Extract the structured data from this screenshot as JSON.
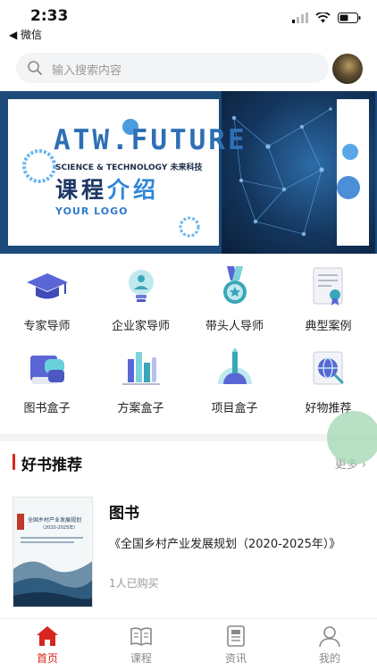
{
  "status_bar": {
    "time": "2:33",
    "back_app": "◀ 微信"
  },
  "search": {
    "placeholder": "输入搜索内容"
  },
  "banner": {
    "title": "ATW.FUTURE",
    "subtitle": "SCIENCE & TECHNOLOGY 未来科技",
    "heading_dark": "课程",
    "heading_light": "介绍",
    "logo_text": "YOUR LOGO"
  },
  "grid": [
    {
      "label": "专家导师",
      "icon": "graduation-cap-icon"
    },
    {
      "label": "企业家导师",
      "icon": "lightbulb-person-icon"
    },
    {
      "label": "带头人导师",
      "icon": "medal-icon"
    },
    {
      "label": "典型案例",
      "icon": "certificate-document-icon"
    },
    {
      "label": "图书盒子",
      "icon": "books-icon"
    },
    {
      "label": "方案盒子",
      "icon": "charts-icon"
    },
    {
      "label": "项目盒子",
      "icon": "pencil-dome-icon"
    },
    {
      "label": "好物推荐",
      "icon": "globe-frame-icon"
    }
  ],
  "section": {
    "title": "好书推荐",
    "more": "更多 ›"
  },
  "book": {
    "category": "图书",
    "description": "《全国乡村产业发展规划（2020-2025年）》",
    "purchases": "1人已购买",
    "cover_title": "全国乡村产业发展规划",
    "cover_subtitle": "（2020-2025年）"
  },
  "tabs": [
    {
      "label": "首页",
      "icon": "home-icon",
      "active": true
    },
    {
      "label": "课程",
      "icon": "book-open-icon",
      "active": false
    },
    {
      "label": "资讯",
      "icon": "news-icon",
      "active": false
    },
    {
      "label": "我的",
      "icon": "user-icon",
      "active": false
    }
  ],
  "colors": {
    "accent": "#d7261e",
    "brand_blue": "#2e6fb5",
    "banner_navy": "#1c4a7a"
  }
}
